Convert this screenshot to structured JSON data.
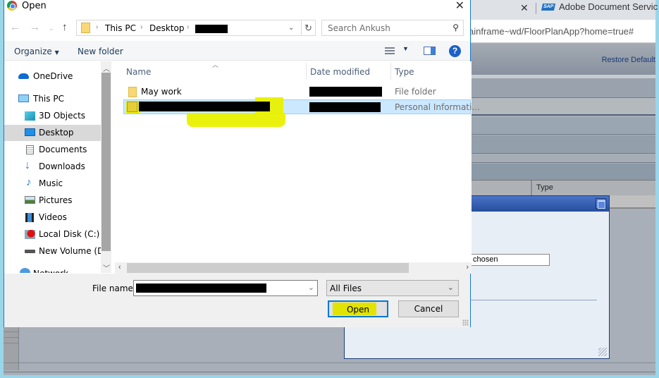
{
  "browser": {
    "tab_title": "Adobe Document Servic",
    "tab_icon": "sap-logo-icon",
    "address_text": "ainframe~wd/FloorPlanApp?home=true#",
    "restore_link": "Restore Default",
    "table_column_type": "Type",
    "popup_input_value": "chosen"
  },
  "dialog": {
    "title": "Open",
    "breadcrumb": [
      "This PC",
      "Desktop",
      "[redacted]"
    ],
    "search_placeholder": "Search Ankush",
    "toolbar": {
      "organize": "Organize",
      "new_folder": "New folder"
    },
    "nav_items": [
      {
        "label": "OneDrive",
        "icon": "onedrive-icon"
      },
      {
        "label": "This PC",
        "icon": "computer-icon"
      },
      {
        "label": "3D Objects",
        "icon": "3d-objects-icon"
      },
      {
        "label": "Desktop",
        "icon": "desktop-icon",
        "selected": true
      },
      {
        "label": "Documents",
        "icon": "documents-icon"
      },
      {
        "label": "Downloads",
        "icon": "downloads-icon"
      },
      {
        "label": "Music",
        "icon": "music-icon"
      },
      {
        "label": "Pictures",
        "icon": "pictures-icon"
      },
      {
        "label": "Videos",
        "icon": "videos-icon"
      },
      {
        "label": "Local Disk (C:)",
        "icon": "local-disk-icon"
      },
      {
        "label": "New Volume (D:)",
        "icon": "drive-icon"
      },
      {
        "label": "Network",
        "icon": "network-icon"
      }
    ],
    "columns": {
      "name": "Name",
      "date": "Date modified",
      "type": "Type"
    },
    "files": [
      {
        "name": "May work",
        "date": "[redacted]",
        "type": "File folder",
        "icon": "folder-icon"
      },
      {
        "name": "[redacted]",
        "date": "[redacted]",
        "type": "Personal Informati...",
        "icon": "personal-information-exchange-icon",
        "selected": true
      }
    ],
    "file_name_label": "File name:",
    "file_name_value": "[redacted]",
    "file_type_value": "All Files",
    "open_button": "Open",
    "cancel_button": "Cancel"
  }
}
